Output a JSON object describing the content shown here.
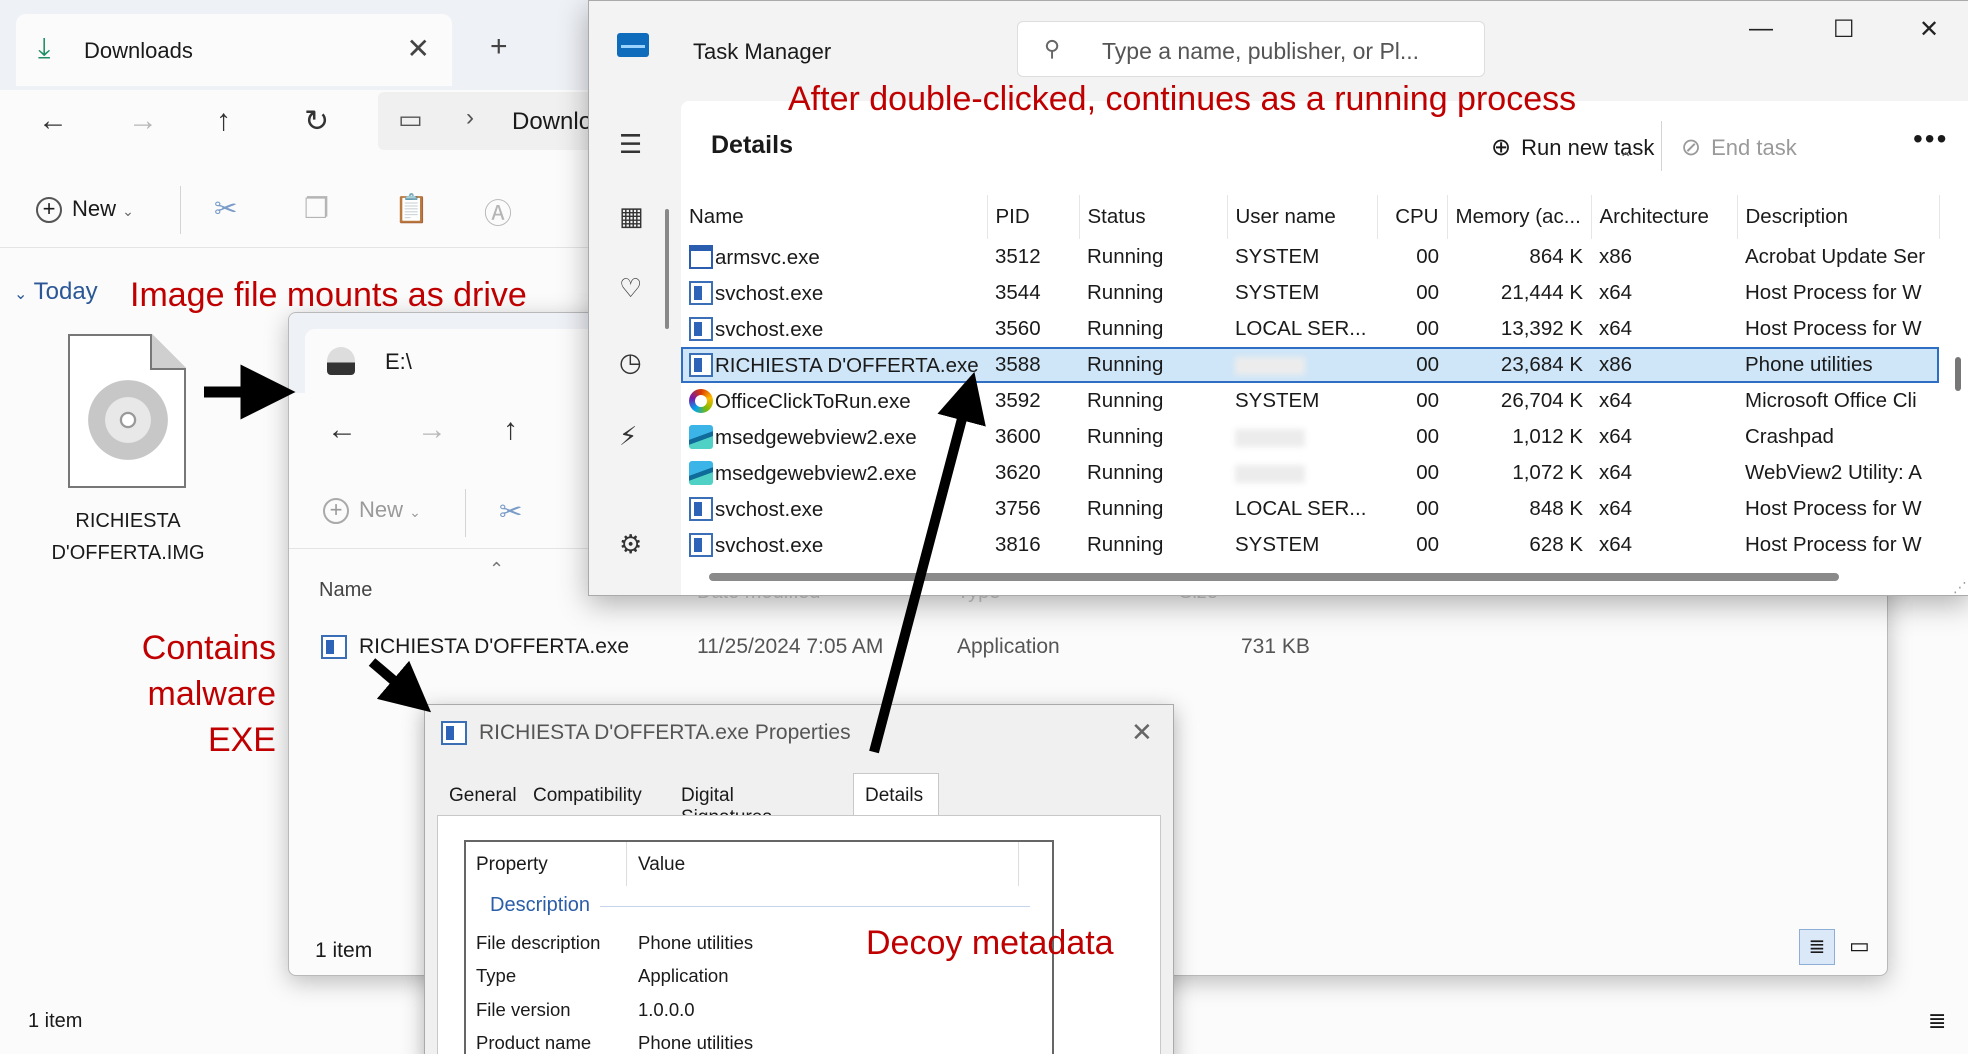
{
  "downloads_window": {
    "tab_title": "Downloads",
    "crumb": "Downlo",
    "new_label": "New",
    "group_label": "Today",
    "file_name": "RICHIESTA D'OFFERTA.IMG",
    "status": "1 item"
  },
  "drive_window": {
    "tab_title": "E:\\",
    "new_label": "New",
    "col_name": "Name",
    "col_date": "Date modified",
    "col_type": "Type",
    "col_size": "Size",
    "file": {
      "name": "RICHIESTA D'OFFERTA.exe",
      "date": "11/25/2024 7:05 AM",
      "type": "Application",
      "size": "731 KB"
    },
    "status": "1 item"
  },
  "task_manager": {
    "title": "Task Manager",
    "search_placeholder": "Type a name, publisher, or Pl...",
    "page_title": "Details",
    "run_new_task": "Run new task",
    "end_task": "End task",
    "columns": [
      "Name",
      "PID",
      "Status",
      "User name",
      "CPU",
      "Memory (ac...",
      "Architecture",
      "Description"
    ],
    "rows": [
      {
        "icon": "armsvc",
        "name": "armsvc.exe",
        "pid": "3512",
        "status": "Running",
        "user": "SYSTEM",
        "cpu": "00",
        "mem": "864 K",
        "arch": "x86",
        "desc": "Acrobat Update Ser",
        "selected": false
      },
      {
        "icon": "svchost",
        "name": "svchost.exe",
        "pid": "3544",
        "status": "Running",
        "user": "SYSTEM",
        "cpu": "00",
        "mem": "21,444 K",
        "arch": "x64",
        "desc": "Host Process for W",
        "selected": false
      },
      {
        "icon": "svchost",
        "name": "svchost.exe",
        "pid": "3560",
        "status": "Running",
        "user": "LOCAL SER...",
        "cpu": "00",
        "mem": "13,392 K",
        "arch": "x64",
        "desc": "Host Process for W",
        "selected": false
      },
      {
        "icon": "svchost",
        "name": "RICHIESTA D'OFFERTA.exe",
        "pid": "3588",
        "status": "Running",
        "user": "",
        "cpu": "00",
        "mem": "23,684 K",
        "arch": "x86",
        "desc": "Phone utilities",
        "selected": true
      },
      {
        "icon": "office",
        "name": "OfficeClickToRun.exe",
        "pid": "3592",
        "status": "Running",
        "user": "SYSTEM",
        "cpu": "00",
        "mem": "26,704 K",
        "arch": "x64",
        "desc": "Microsoft Office Cli",
        "selected": false
      },
      {
        "icon": "edge",
        "name": "msedgewebview2.exe",
        "pid": "3600",
        "status": "Running",
        "user": "",
        "cpu": "00",
        "mem": "1,012 K",
        "arch": "x64",
        "desc": "Crashpad",
        "selected": false
      },
      {
        "icon": "edge",
        "name": "msedgewebview2.exe",
        "pid": "3620",
        "status": "Running",
        "user": "",
        "cpu": "00",
        "mem": "1,072 K",
        "arch": "x64",
        "desc": "WebView2 Utility: A",
        "selected": false
      },
      {
        "icon": "svchost",
        "name": "svchost.exe",
        "pid": "3756",
        "status": "Running",
        "user": "LOCAL SER...",
        "cpu": "00",
        "mem": "848 K",
        "arch": "x64",
        "desc": "Host Process for W",
        "selected": false
      },
      {
        "icon": "svchost",
        "name": "svchost.exe",
        "pid": "3816",
        "status": "Running",
        "user": "SYSTEM",
        "cpu": "00",
        "mem": "628 K",
        "arch": "x64",
        "desc": "Host Process for W",
        "selected": false
      }
    ]
  },
  "properties_dialog": {
    "title": "RICHIESTA D'OFFERTA.exe Properties",
    "tabs": [
      "General",
      "Compatibility",
      "Digital Signatures",
      "Details"
    ],
    "col_property": "Property",
    "col_value": "Value",
    "group": "Description",
    "rows": [
      {
        "property": "File description",
        "value": "Phone utilities"
      },
      {
        "property": "Type",
        "value": "Application"
      },
      {
        "property": "File version",
        "value": "1.0.0.0"
      },
      {
        "property": "Product name",
        "value": "Phone utilities"
      }
    ]
  },
  "annotations": {
    "running": "After double-clicked, continues as a running process",
    "mounts": "Image file mounts as drive",
    "contains_line1": "Contains",
    "contains_line2": "malware",
    "contains_line3": "EXE",
    "decoy": "Decoy metadata"
  },
  "colors": {
    "annotation": "#c00000",
    "selection": "#cfe6f8",
    "accent": "#2f6ec2"
  }
}
